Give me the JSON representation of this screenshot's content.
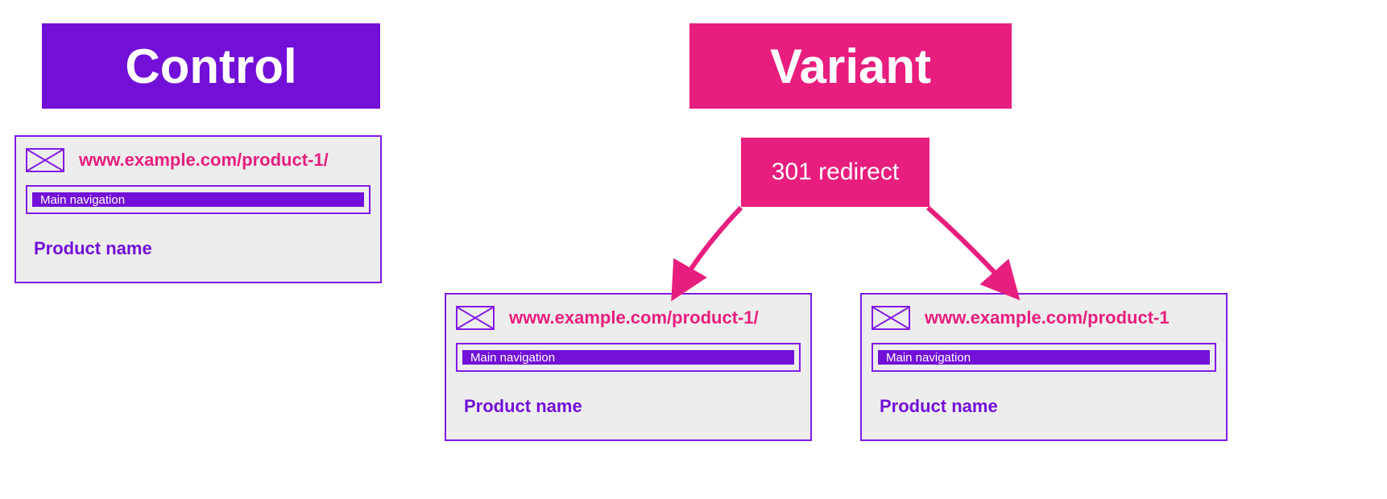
{
  "titles": {
    "control": "Control",
    "variant": "Variant"
  },
  "redirect_label": "301 redirect",
  "colors": {
    "purple": "#7210d8",
    "pink": "#e81e7e",
    "border_purple": "#8319e7",
    "card_bg": "#eeeded"
  },
  "control_page": {
    "url": "www.example.com/product-1/",
    "nav_label": "Main navigation",
    "product_label": "Product name"
  },
  "variant_page_left": {
    "url": "www.example.com/product-1/",
    "nav_label": "Main navigation",
    "product_label": "Product name"
  },
  "variant_page_right": {
    "url": "www.example.com/product-1",
    "nav_label": "Main navigation",
    "product_label": "Product name"
  }
}
